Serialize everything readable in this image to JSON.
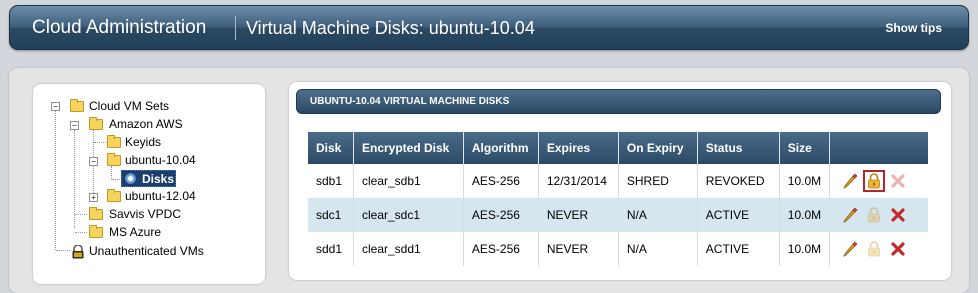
{
  "header": {
    "app_title": "Cloud Administration",
    "page_title": "Virtual Machine Disks: ubuntu-10.04",
    "show_tips": "Show tips"
  },
  "tree": {
    "cloud_vm_sets": "Cloud VM Sets",
    "amazon_aws": "Amazon AWS",
    "keyids": "Keyids",
    "ubuntu_1004": "ubuntu-10.04",
    "disks": "Disks",
    "ubuntu_1204": "ubuntu-12.04",
    "savvis_vpdc": "Savvis VPDC",
    "ms_azure": "MS Azure",
    "unauthenticated_vms": "Unauthenticated VMs"
  },
  "panel": {
    "title": "UBUNTU-10.04 VIRTUAL MACHINE DISKS"
  },
  "table": {
    "columns": [
      "Disk",
      "Encrypted Disk",
      "Algorithm",
      "Expires",
      "On Expiry",
      "Status",
      "Size",
      ""
    ],
    "rows": [
      {
        "disk": "sdb1",
        "encrypted": "clear_sdb1",
        "algorithm": "AES-256",
        "expires": "12/31/2014",
        "on_expiry": "SHRED",
        "status": "REVOKED",
        "size": "10.0M",
        "lock_enabled": true,
        "delete_enabled": false,
        "lock_highlighted": true
      },
      {
        "disk": "sdc1",
        "encrypted": "clear_sdc1",
        "algorithm": "AES-256",
        "expires": "NEVER",
        "on_expiry": "N/A",
        "status": "ACTIVE",
        "size": "10.0M",
        "lock_enabled": false,
        "delete_enabled": true,
        "lock_highlighted": false
      },
      {
        "disk": "sdd1",
        "encrypted": "clear_sdd1",
        "algorithm": "AES-256",
        "expires": "NEVER",
        "on_expiry": "N/A",
        "status": "ACTIVE",
        "size": "10.0M",
        "lock_enabled": false,
        "delete_enabled": true,
        "lock_highlighted": false
      }
    ]
  },
  "colors": {
    "header_dark": "#22405a",
    "selected_node": "#1a3e6e",
    "row_alt": "#d6e6ef",
    "delete_red": "#c0282a",
    "highlight_red": "#b5262a"
  },
  "icons": [
    "folder-icon",
    "disk-icon",
    "lock-icon",
    "edit-pencil-icon",
    "delete-x-icon"
  ]
}
